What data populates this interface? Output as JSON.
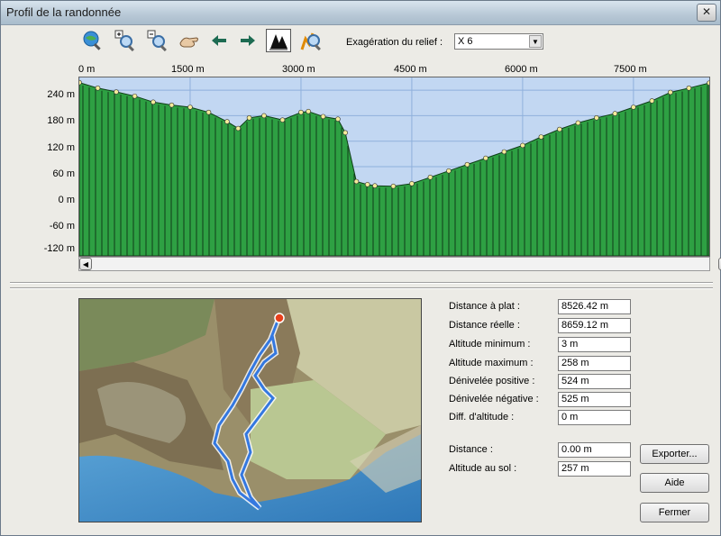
{
  "window": {
    "title": "Profil de la randonnée",
    "close_label": "✕"
  },
  "toolbar": {
    "icons": [
      "globe-zoom-icon",
      "zoom-in-icon",
      "zoom-out-icon",
      "pan-hand-icon",
      "back-arrow-icon",
      "forward-arrow-icon",
      "trees-terrain-icon",
      "route-zoom-icon"
    ],
    "relief_label": "Exagération du relief :",
    "relief_value": "X 6"
  },
  "profile": {
    "x_ticks": [
      "0 m",
      "1500 m",
      "3000 m",
      "4500 m",
      "6000 m",
      "7500 m"
    ],
    "y_ticks": [
      "240 m",
      "180 m",
      "120 m",
      "60 m",
      "0 m",
      "-60 m",
      "-120 m"
    ]
  },
  "chart_data": {
    "type": "area",
    "xlabel": "",
    "ylabel": "",
    "xlim": [
      0,
      8526
    ],
    "ylim": [
      -150,
      270
    ],
    "x": [
      0,
      250,
      500,
      750,
      1000,
      1250,
      1500,
      1750,
      2000,
      2150,
      2300,
      2500,
      2750,
      3000,
      3100,
      3300,
      3500,
      3600,
      3750,
      3900,
      4000,
      4250,
      4500,
      4750,
      5000,
      5250,
      5500,
      5750,
      6000,
      6250,
      6500,
      6750,
      7000,
      7250,
      7500,
      7750,
      8000,
      8250,
      8526
    ],
    "y": [
      258,
      245,
      236,
      226,
      212,
      205,
      200,
      188,
      166,
      150,
      175,
      180,
      170,
      188,
      190,
      178,
      172,
      140,
      25,
      18,
      15,
      14,
      20,
      35,
      50,
      65,
      80,
      95,
      110,
      130,
      148,
      163,
      175,
      185,
      200,
      215,
      235,
      245,
      257
    ],
    "area_color": "#2ea043",
    "sky_color": "#c2d7f2"
  },
  "stats": [
    {
      "label": "Distance à plat :",
      "value": "8526.42 m"
    },
    {
      "label": "Distance réelle :",
      "value": "8659.12 m"
    },
    {
      "label": "Altitude minimum :",
      "value": "3 m"
    },
    {
      "label": "Altitude maximum :",
      "value": "258 m"
    },
    {
      "label": "Dénivelée positive :",
      "value": "524 m"
    },
    {
      "label": "Dénivelée négative :",
      "value": "525 m"
    },
    {
      "label": "Diff. d'altitude :",
      "value": "0 m"
    }
  ],
  "cursor": [
    {
      "label": "Distance :",
      "value": "0.00 m"
    },
    {
      "label": "Altitude au sol :",
      "value": "257 m"
    }
  ],
  "buttons": {
    "export": "Exporter...",
    "help": "Aide",
    "close": "Fermer"
  }
}
